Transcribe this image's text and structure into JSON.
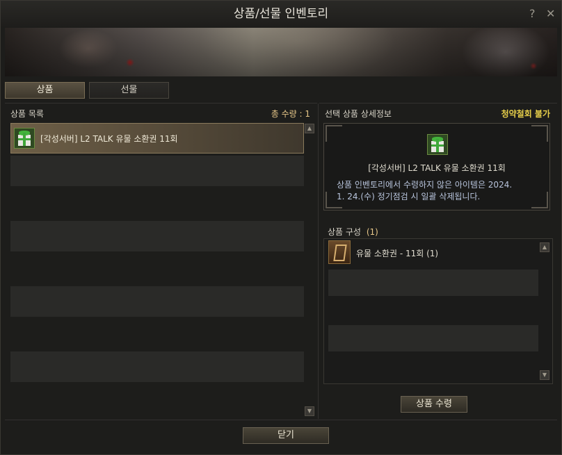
{
  "window": {
    "title": "상품/선물 인벤토리",
    "help_label": "?",
    "close_label": "✕"
  },
  "tabs": [
    {
      "label": "상품"
    },
    {
      "label": "선물"
    }
  ],
  "product_list": {
    "header": "상품 목록",
    "count_label": "총 수량 : 1",
    "items": [
      {
        "name": "[각성서버] L2 TALK 유물 소환권 11회",
        "icon": "gift-box-icon"
      }
    ]
  },
  "detail": {
    "header": "선택 상품 상세정보",
    "refund_status": "청약철회 불가",
    "item_name": "[각성서버] L2 TALK 유물 소환권 11회",
    "notice_line1": "상품 인벤토리에서 수령하지 않은 아이템은 2024.",
    "notice_line2": "1. 24.(수) 정기점검 시 일괄 삭제됩니다.",
    "composition_label": "상품 구성",
    "composition_count": "(1)",
    "components": [
      {
        "name": "유물 소환권 - 11회 (1)",
        "icon": "summon-card-icon"
      }
    ]
  },
  "buttons": {
    "receive": "상품 수령",
    "close": "닫기"
  },
  "colors": {
    "accent_yellow": "#e8d04a",
    "count_orange": "#e8c88a",
    "selected_row": "#6e5f47"
  }
}
